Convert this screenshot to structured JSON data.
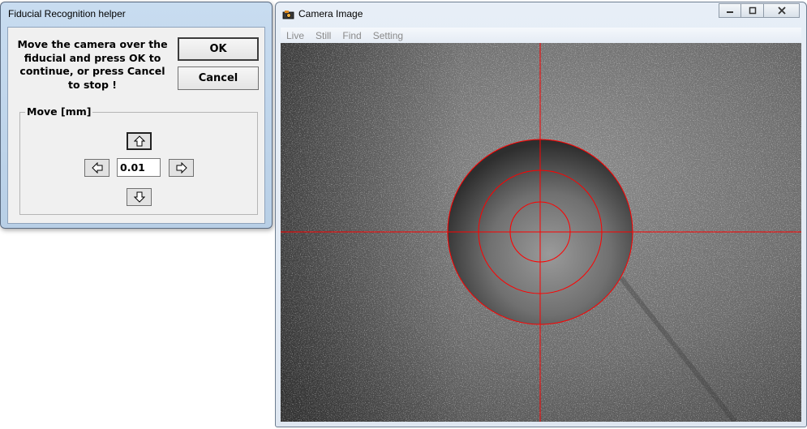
{
  "dialog": {
    "title": "Fiducial Recognition helper",
    "instructions": "Move the camera over the fiducial and press OK to continue, or press Cancel to stop !",
    "ok_label": "OK",
    "cancel_label": "Cancel",
    "move_group_label": "Move [mm]",
    "step_value": "0.01",
    "arrows": [
      "arrow-up-icon",
      "arrow-left-icon",
      "arrow-right-icon",
      "arrow-down-icon"
    ]
  },
  "camera_window": {
    "title": "Camera Image",
    "icon": "camera-icon",
    "menu": [
      "Live",
      "Still",
      "Find",
      "Setting"
    ],
    "caption_buttons": [
      "minimize-icon",
      "maximize-icon",
      "close-icon"
    ],
    "overlay_color": "#ff0000"
  }
}
